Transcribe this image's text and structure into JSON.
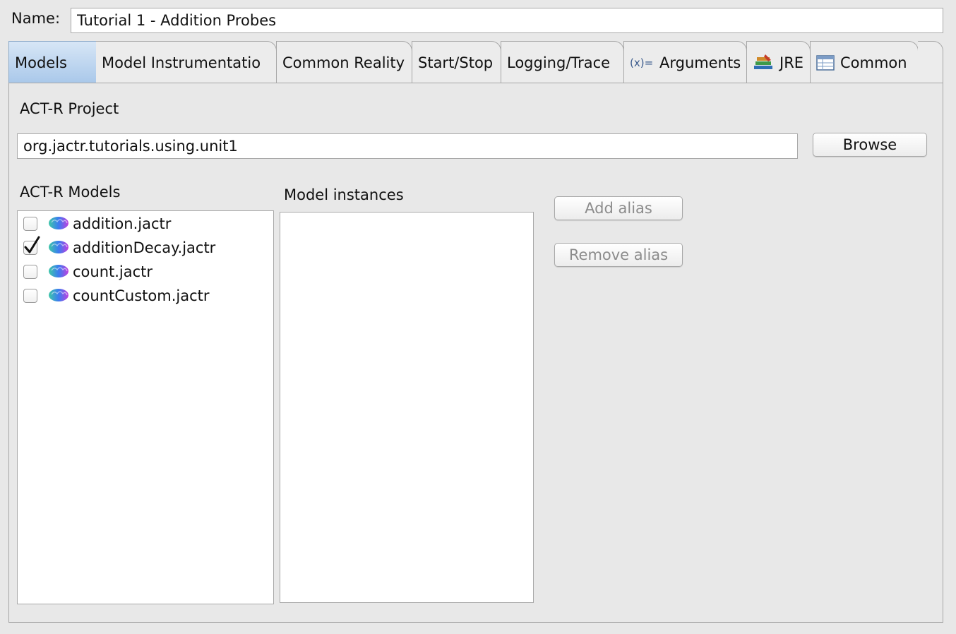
{
  "name_field": {
    "label": "Name:",
    "value": "Tutorial 1 - Addition Probes"
  },
  "tabs": [
    {
      "label": "Models",
      "active": true
    },
    {
      "label": "Model Instrumentatio",
      "active": false
    },
    {
      "label": "Common Reality",
      "active": false
    },
    {
      "label": "Start/Stop",
      "active": false
    },
    {
      "label": "Logging/Trace",
      "active": false
    },
    {
      "label": "Arguments",
      "icon": "variables-icon",
      "active": false
    },
    {
      "label": "JRE",
      "icon": "library-icon",
      "active": false
    },
    {
      "label": "Common",
      "icon": "table-icon",
      "active": false
    }
  ],
  "project": {
    "label": "ACT-R Project",
    "value": "org.jactr.tutorials.using.unit1",
    "browse_label": "Browse"
  },
  "models": {
    "label": "ACT-R Models",
    "items": [
      {
        "name": "addition.jactr",
        "checked": false
      },
      {
        "name": "additionDecay.jactr",
        "checked": true
      },
      {
        "name": "count.jactr",
        "checked": false
      },
      {
        "name": "countCustom.jactr",
        "checked": false
      }
    ]
  },
  "instances": {
    "label": "Model instances"
  },
  "alias_buttons": {
    "add_label": "Add alias",
    "remove_label": "Remove alias",
    "enabled": false
  },
  "colors": {
    "active_tab": "#a9c8ea",
    "panel_bg": "#e8e8e8"
  }
}
